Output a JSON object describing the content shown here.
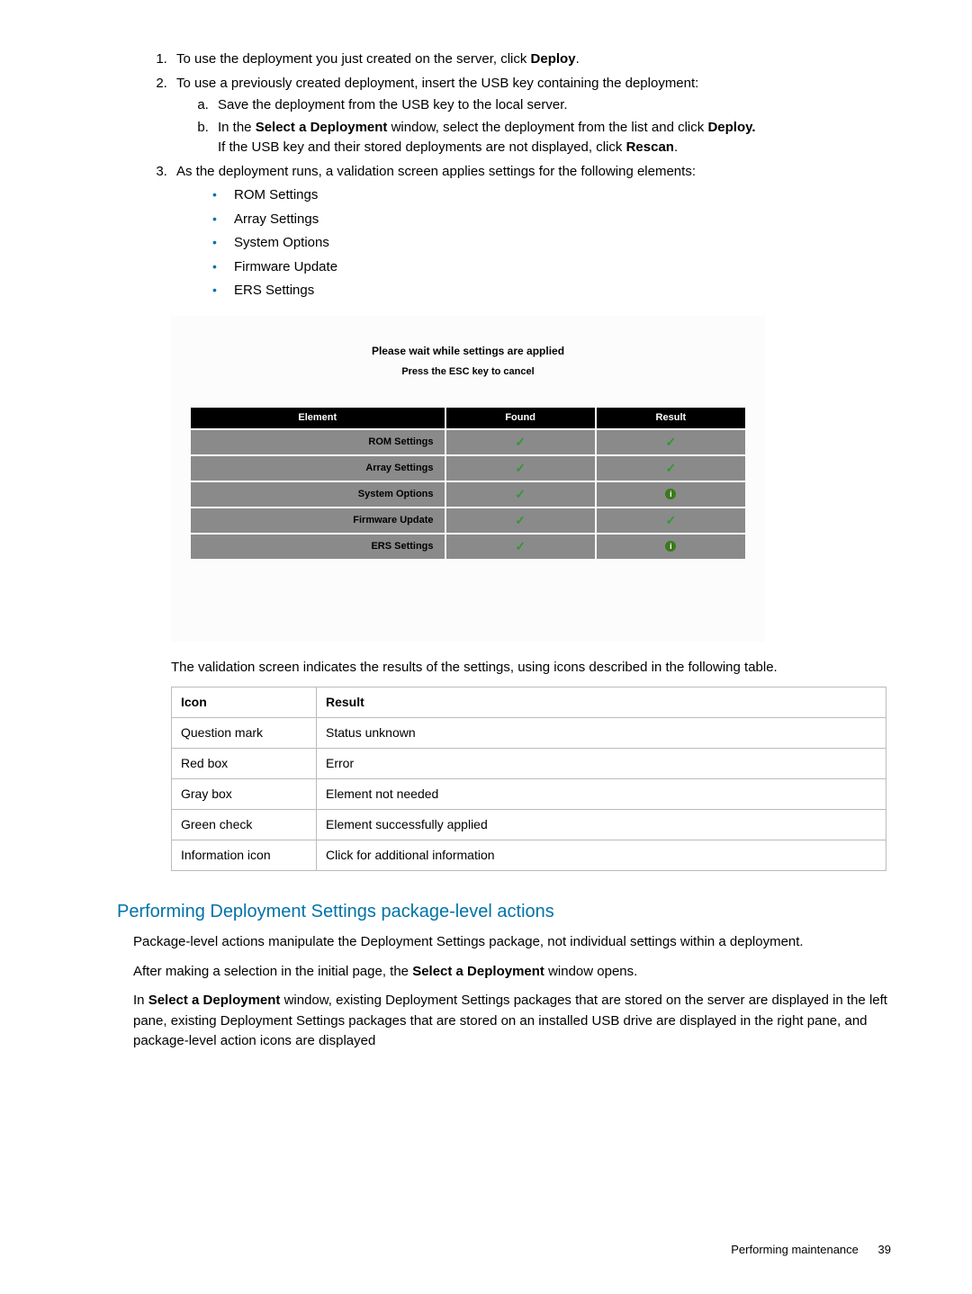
{
  "steps": {
    "1": {
      "pre": "To use the deployment you just created on the server, click ",
      "bold": "Deploy",
      "post": "."
    },
    "2": {
      "text": "To use a previously created deployment, insert the USB key containing the deployment:",
      "a": "Save the deployment from the USB key to the local server.",
      "b": {
        "pre": "In the ",
        "b1": "Select a Deployment",
        "mid": " window, select the deployment from the list and click ",
        "b2": "Deploy.",
        "line2pre": "If the USB key and their stored deployments are not displayed, click ",
        "b3": "Rescan",
        "post": "."
      }
    },
    "3": {
      "text": "As the deployment runs, a validation screen applies settings for the following elements:",
      "bullets": [
        "ROM Settings",
        "Array Settings",
        "System Options",
        "Firmware Update",
        "ERS Settings"
      ]
    }
  },
  "panel": {
    "title": "Please wait while settings are applied",
    "subtitle": "Press the ESC key to cancel",
    "headers": [
      "Element",
      "Found",
      "Result"
    ],
    "rows": [
      {
        "element": "ROM Settings",
        "found": "check",
        "result": "check"
      },
      {
        "element": "Array Settings",
        "found": "check",
        "result": "check"
      },
      {
        "element": "System Options",
        "found": "check",
        "result": "info"
      },
      {
        "element": "Firmware Update",
        "found": "check",
        "result": "check"
      },
      {
        "element": "ERS Settings",
        "found": "check",
        "result": "info"
      }
    ]
  },
  "afterPanel": "The validation screen indicates the results of the settings, using icons described in the following table.",
  "resultTable": {
    "headers": [
      "Icon",
      "Result"
    ],
    "rows": [
      [
        "Question mark",
        "Status unknown"
      ],
      [
        "Red box",
        "Error"
      ],
      [
        "Gray box",
        "Element not needed"
      ],
      [
        "Green check",
        "Element successfully applied"
      ],
      [
        "Information icon",
        "Click for additional information"
      ]
    ]
  },
  "section": {
    "heading": "Performing Deployment Settings package-level actions",
    "p1": "Package-level actions manipulate the Deployment Settings package, not individual settings within a deployment.",
    "p2pre": "After making a selection in the initial page, the ",
    "p2bold": "Select a Deployment",
    "p2post": " window opens.",
    "p3a": "In ",
    "p3bold": "Select a Deployment",
    "p3b": " window, existing Deployment Settings packages that are stored on the server are displayed in the left pane, existing Deployment Settings packages that are stored on an installed USB drive are displayed in the right pane, and package-level action icons are displayed"
  },
  "footer": {
    "text": "Performing maintenance",
    "page": "39"
  }
}
